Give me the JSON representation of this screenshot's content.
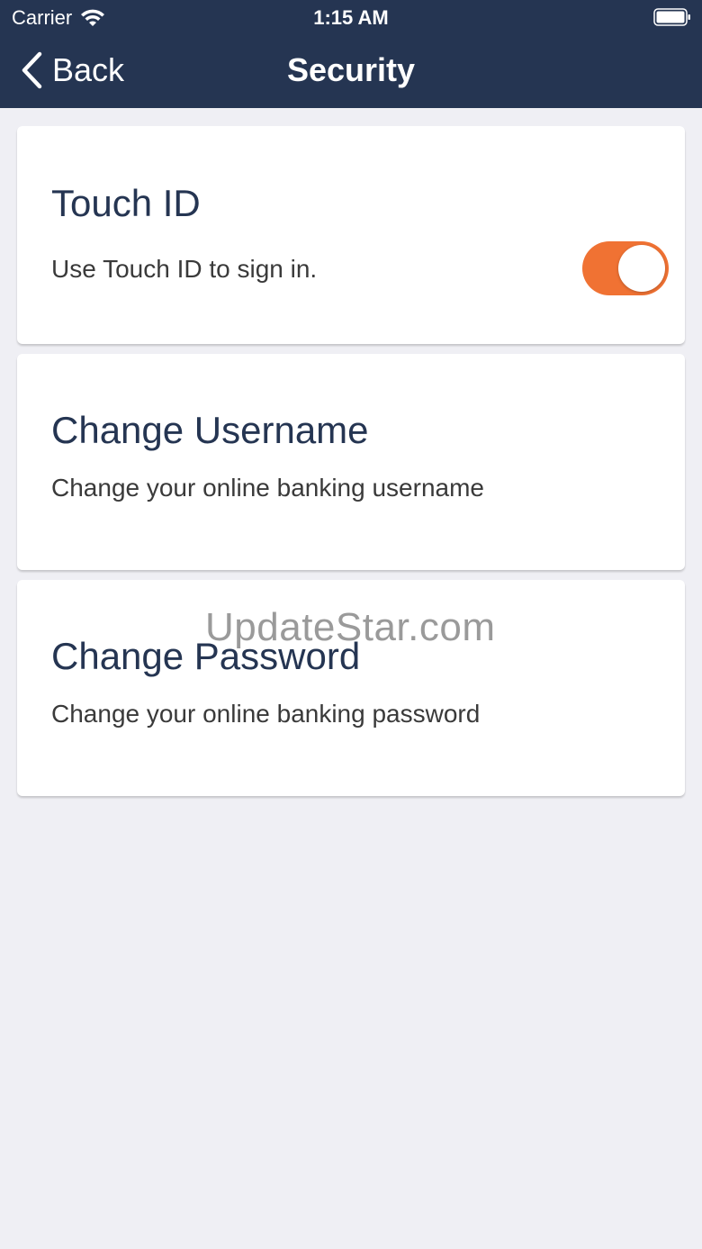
{
  "status_bar": {
    "carrier": "Carrier",
    "time": "1:15 AM",
    "wifi_icon": "wifi-icon",
    "battery_icon": "battery-icon"
  },
  "nav": {
    "back_label": "Back",
    "back_icon": "chevron-left-icon",
    "title": "Security"
  },
  "cards": {
    "touch_id": {
      "title": "Touch ID",
      "subtitle": "Use Touch ID to sign in.",
      "toggle_on": true
    },
    "change_username": {
      "title": "Change Username",
      "subtitle": "Change your online banking username"
    },
    "change_password": {
      "title": "Change Password",
      "subtitle": "Change your online banking password"
    }
  },
  "watermark": "UpdateStar.com",
  "colors": {
    "header_bg": "#253552",
    "accent": "#f07233",
    "page_bg": "#efeff4",
    "title_text": "#253552"
  }
}
